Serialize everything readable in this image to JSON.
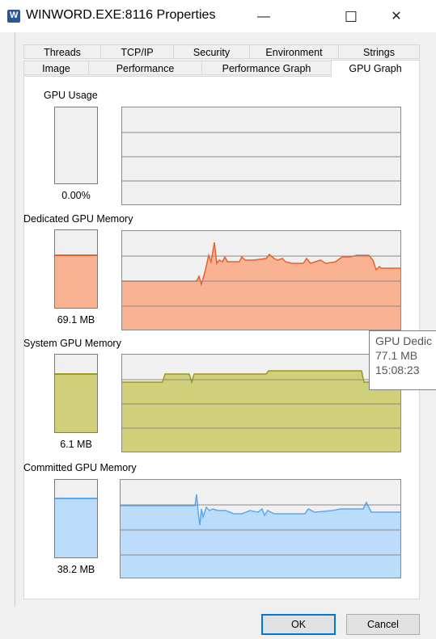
{
  "window": {
    "title": "WINWORD.EXE:8116 Properties",
    "minimize_glyph": "—",
    "maximize_glyph": "☐",
    "close_glyph": "✕"
  },
  "tabs": {
    "row1": [
      "Threads",
      "TCP/IP",
      "Security",
      "Environment",
      "Strings"
    ],
    "row2": [
      "Image",
      "Performance",
      "Performance Graph",
      "GPU Graph"
    ],
    "active": "GPU Graph"
  },
  "sections": [
    {
      "label": "GPU Usage",
      "value": "0.00%",
      "fill_fraction": 0.0,
      "color": "#ffb48c",
      "line_color": "#e8602c"
    },
    {
      "label": "Dedicated GPU Memory",
      "value": "69.1 MB",
      "fill_fraction": 0.67,
      "color": "#f9b393",
      "line_color": "#e8602c"
    },
    {
      "label": "System GPU Memory",
      "value": "6.1 MB",
      "fill_fraction": 0.74,
      "color": "#d1d07a",
      "line_color": "#9a9a1e"
    },
    {
      "label": "Committed GPU Memory",
      "value": "38.2 MB",
      "fill_fraction": 0.75,
      "color": "#bcdcfc",
      "line_color": "#5aa8f0"
    }
  ],
  "tooltip": {
    "line1": "GPU Dedic",
    "line2": "77.1 MB",
    "line3": "15:08:23"
  },
  "buttons": {
    "ok": "OK",
    "cancel": "Cancel"
  }
}
